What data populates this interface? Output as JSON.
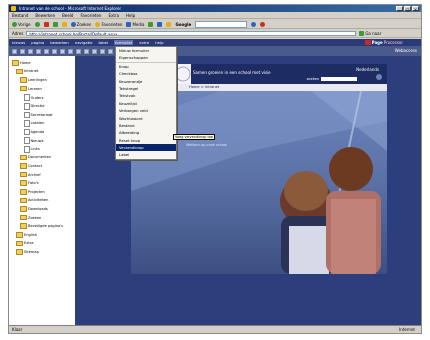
{
  "window": {
    "title": "Intranet van de school - Microsoft Internet Explorer",
    "minimize": "_",
    "maximize": "□",
    "close": "×"
  },
  "ie_menu": [
    "Bestand",
    "Bewerken",
    "Beeld",
    "Favorieten",
    "Extra",
    "Help"
  ],
  "ie_toolbar": {
    "back": "Vorige",
    "search": "Zoeken",
    "favorites": "Favorieten",
    "media": "Media",
    "google": "Google"
  },
  "address": {
    "label": "Adres",
    "value": "http://intranet.school.be/Portal/Default.aspx",
    "go": "Ga naar"
  },
  "app_menu": [
    "nieuws",
    "pagina",
    "bewerken",
    "navigatie",
    "tabel",
    "formulier",
    "extra",
    "help"
  ],
  "app_menu_open": "formulier",
  "brand": {
    "name": "Page",
    "suffix": "Processor"
  },
  "app_toolbar": {
    "right_label": "Webaccess"
  },
  "sidebar": {
    "items": [
      {
        "label": "Home",
        "indent": 0,
        "kind": "folder"
      },
      {
        "label": "Intranet",
        "indent": 1,
        "kind": "folder"
      },
      {
        "label": "Leerlingen",
        "indent": 2,
        "kind": "folder"
      },
      {
        "label": "Leraren",
        "indent": 2,
        "kind": "folder"
      },
      {
        "label": "Ouders",
        "indent": 3,
        "kind": "doc"
      },
      {
        "label": "Directie",
        "indent": 3,
        "kind": "doc"
      },
      {
        "label": "Secretariaat",
        "indent": 3,
        "kind": "doc"
      },
      {
        "label": "Lokalen",
        "indent": 3,
        "kind": "doc"
      },
      {
        "label": "Agenda",
        "indent": 3,
        "kind": "doc"
      },
      {
        "label": "Nieuws",
        "indent": 3,
        "kind": "doc"
      },
      {
        "label": "Links",
        "indent": 3,
        "kind": "doc"
      },
      {
        "label": "Documenten",
        "indent": 2,
        "kind": "folder"
      },
      {
        "label": "Contact",
        "indent": 2,
        "kind": "folder"
      },
      {
        "label": "Archief",
        "indent": 2,
        "kind": "folder"
      },
      {
        "label": "Foto's",
        "indent": 2,
        "kind": "folder"
      },
      {
        "label": "Projecten",
        "indent": 2,
        "kind": "folder"
      },
      {
        "label": "Activiteiten",
        "indent": 2,
        "kind": "folder"
      },
      {
        "label": "Downloads",
        "indent": 2,
        "kind": "folder"
      },
      {
        "label": "Zoeken",
        "indent": 2,
        "kind": "folder"
      },
      {
        "label": "Beveiligde pagina's",
        "indent": 2,
        "kind": "folder"
      },
      {
        "label": "English",
        "indent": 1,
        "kind": "folder"
      },
      {
        "label": "Extra",
        "indent": 1,
        "kind": "folder"
      },
      {
        "label": "Sitemap",
        "indent": 1,
        "kind": "folder"
      }
    ]
  },
  "dropdown": {
    "items": [
      {
        "label": "Nieuw formulier",
        "sep": false
      },
      {
        "label": "Eigenschappen",
        "sep": true
      },
      {
        "label": "Knop",
        "sep": false
      },
      {
        "label": "Checkbox",
        "sep": false
      },
      {
        "label": "Keuzerondje",
        "sep": false
      },
      {
        "label": "Tekstregel",
        "sep": false
      },
      {
        "label": "Tekstvak",
        "sep": false
      },
      {
        "label": "Keuzelijst",
        "sep": false
      },
      {
        "label": "Verborgen veld",
        "sep": false
      },
      {
        "label": "Wachtwoord",
        "sep": false
      },
      {
        "label": "Bestand",
        "sep": false
      },
      {
        "label": "Afbeelding",
        "sep": false
      },
      {
        "label": "Reset knop",
        "sep": false
      },
      {
        "label": "Verzendknop",
        "sep": false
      },
      {
        "label": "Label",
        "sep": false
      }
    ],
    "active_index": 13,
    "tooltip": "Voeg verzendknop toe"
  },
  "webpage": {
    "header_text": "Samen groeien in een school met visie",
    "lang": "Nederlands",
    "search_label": "zoeken",
    "nav_text": "Home > Intranet",
    "photo_caption": "Welkom op onze school"
  },
  "status": {
    "left": "Klaar",
    "right": "Internet"
  }
}
